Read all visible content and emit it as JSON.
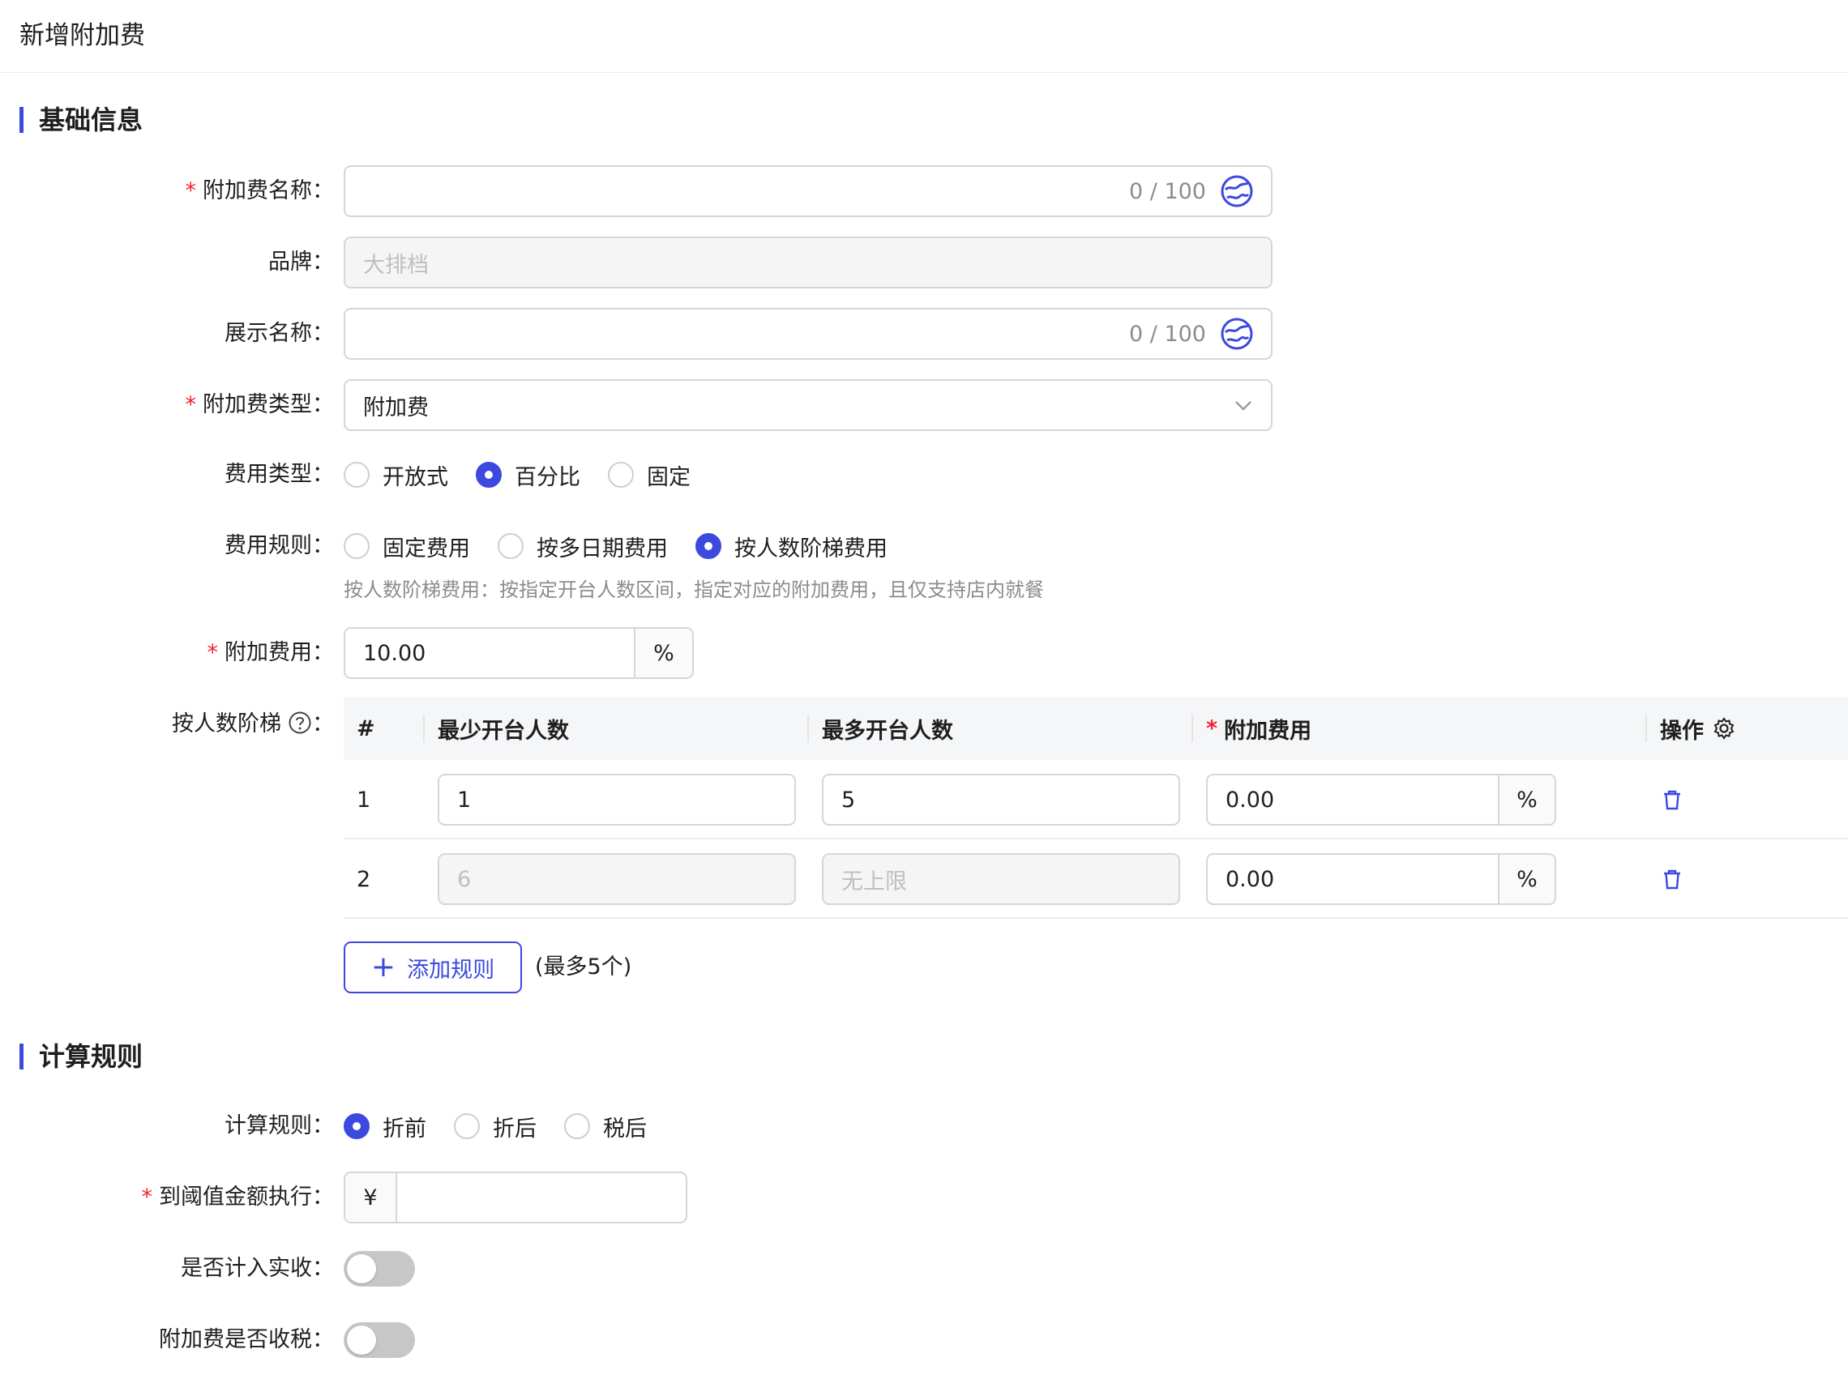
{
  "page": {
    "title": "新增附加费"
  },
  "sections": {
    "basic": "基础信息",
    "calc": "计算规则"
  },
  "form": {
    "name": {
      "label": "附加费名称：",
      "count": "0 / 100"
    },
    "brand": {
      "label": "品牌：",
      "placeholder": "大排档"
    },
    "display_name": {
      "label": "展示名称：",
      "count": "0 / 100"
    },
    "fee_type_select": {
      "label": "附加费类型：",
      "value": "附加费"
    },
    "cost_type": {
      "label": "费用类型：",
      "options": [
        "开放式",
        "百分比",
        "固定"
      ],
      "selected": "百分比"
    },
    "cost_rule": {
      "label": "费用规则：",
      "options": [
        "固定费用",
        "按多日期费用",
        "按人数阶梯费用"
      ],
      "selected": "按人数阶梯费用",
      "hint": "按人数阶梯费用：按指定开台人数区间，指定对应的附加费用，且仅支持店内就餐"
    },
    "surcharge": {
      "label": "附加费用：",
      "value": "10.00",
      "unit": "%"
    },
    "tiers": {
      "label": "按人数阶梯",
      "colon": "：",
      "columns": {
        "index": "#",
        "min": "最少开台人数",
        "max": "最多开台人数",
        "fee": "附加费用",
        "action": "操作"
      },
      "rows": [
        {
          "index": "1",
          "min": "1",
          "max": "5",
          "fee": "0.00",
          "unit": "%"
        },
        {
          "index": "2",
          "min": "6",
          "max": "无上限",
          "fee": "0.00",
          "unit": "%"
        }
      ],
      "add_button": "添加规则",
      "max_note": "(最多5个)"
    },
    "calc_rule": {
      "label": "计算规则：",
      "options": [
        "折前",
        "折后",
        "税后"
      ],
      "selected": "折前"
    },
    "threshold": {
      "label": "到阈值金额执行：",
      "prefix": "¥",
      "value": ""
    },
    "count_received": {
      "label": "是否计入实收：",
      "on": false
    },
    "taxable": {
      "label": "附加费是否收税：",
      "on": false
    }
  },
  "colors": {
    "accent": "#3b49df",
    "required": "#f5222d"
  }
}
